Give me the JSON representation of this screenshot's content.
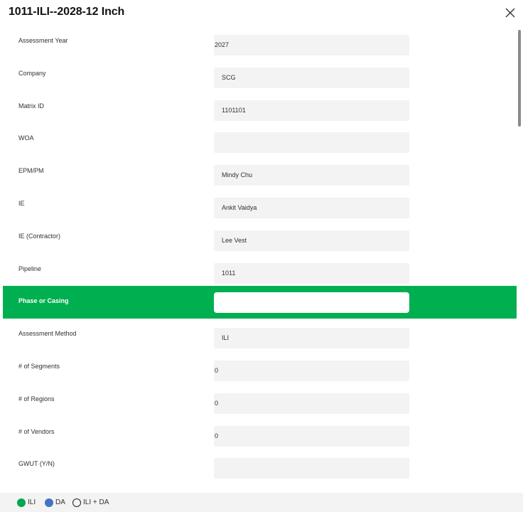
{
  "title": "1011-ILI--2028-12 Inch",
  "fields": [
    {
      "label": "Assessment Year",
      "value": "2027"
    },
    {
      "label": "Company",
      "value": "SCG"
    },
    {
      "label": "Matrix ID",
      "value": "1101101"
    },
    {
      "label": "WOA",
      "value": ""
    },
    {
      "label": "EPM/PM",
      "value": "Mindy Chu"
    },
    {
      "label": "IE",
      "value": "Ankit Vaidya"
    },
    {
      "label": "IE (Contractor)",
      "value": "Lee Vest"
    },
    {
      "label": "Pipeline",
      "value": "1011"
    },
    {
      "label": "Phase or Casing",
      "value": ""
    },
    {
      "label": "Assessment Method",
      "value": "ILI"
    },
    {
      "label": "# of Segments",
      "value": "0"
    },
    {
      "label": "# of Regions",
      "value": "0"
    },
    {
      "label": "# of Vendors",
      "value": "0"
    },
    {
      "label": "GWUT (Y/N)",
      "value": ""
    }
  ],
  "legend": [
    {
      "label": "ILI",
      "color": "#00a651",
      "filled": true
    },
    {
      "label": "DA",
      "color": "#4472c4",
      "filled": true
    },
    {
      "label": "ILI + DA",
      "color": "#222222",
      "filled": false
    }
  ],
  "colors": {
    "highlight": "#00af50"
  }
}
